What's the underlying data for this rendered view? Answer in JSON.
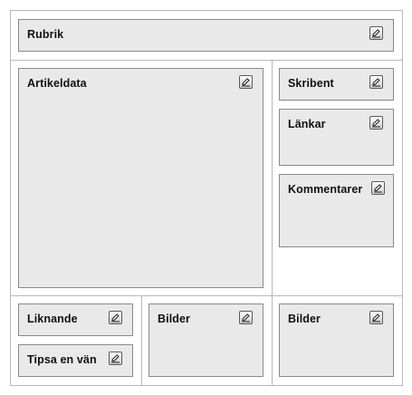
{
  "layout_editor": {
    "edit_icon": "pencil-edit-icon",
    "blocks": {
      "rubrik": {
        "label": "Rubrik"
      },
      "artikeldata": {
        "label": "Artikeldata"
      },
      "skribent": {
        "label": "Skribent"
      },
      "lankar": {
        "label": "Länkar"
      },
      "kommentarer": {
        "label": "Kommentarer"
      },
      "liknande": {
        "label": "Liknande"
      },
      "tipsa": {
        "label": "Tipsa en vän"
      },
      "bilder_mid": {
        "label": "Bilder"
      },
      "bilder_right": {
        "label": "Bilder"
      }
    }
  }
}
